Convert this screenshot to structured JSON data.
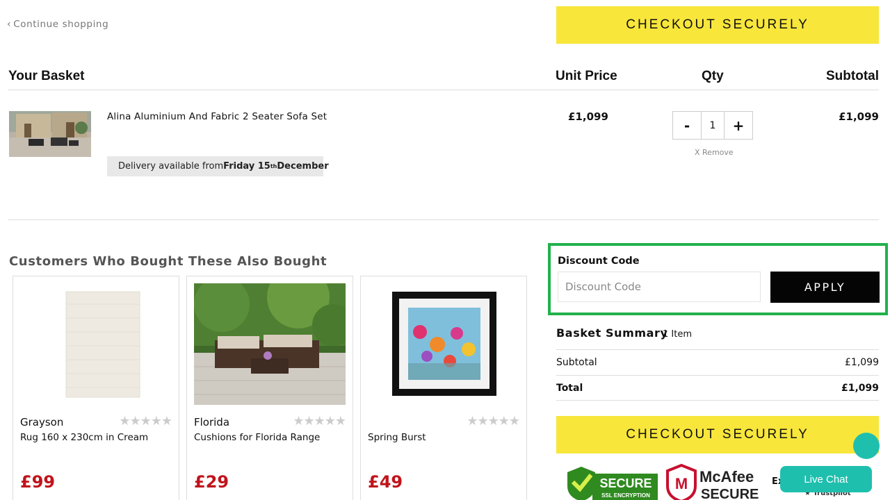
{
  "header": {
    "continue_label": "Continue shopping",
    "checkout_label": "CHECKOUT SECURELY"
  },
  "basket": {
    "title": "Your Basket",
    "columns": {
      "unit_price": "Unit Price",
      "qty": "Qty",
      "subtotal": "Subtotal"
    },
    "item": {
      "name": "Alina Aluminium And Fabric 2 Seater Sofa Set",
      "delivery_prefix": "Delivery available from ",
      "delivery_day": "Friday 15",
      "delivery_suffix": "th",
      "delivery_month": " December",
      "unit_price": "£1,099",
      "qty": "1",
      "qty_minus": "-",
      "qty_plus": "+",
      "subtotal": "£1,099",
      "remove_label": "X Remove"
    }
  },
  "recommendations": {
    "title": "Customers Who Bought These Also Bought",
    "items": [
      {
        "name": "Grayson",
        "subtitle": "Rug 160 x 230cm in Cream",
        "price": "£99",
        "rating": 0
      },
      {
        "name": "Florida",
        "subtitle": "Cushions for Florida Range",
        "price": "£29",
        "rating": 0
      },
      {
        "name": "",
        "subtitle": "Spring Burst",
        "price": "£49",
        "rating": 0
      }
    ],
    "stars": "★★★★★"
  },
  "discount": {
    "label": "Discount Code",
    "placeholder": "Discount Code",
    "apply_label": "APPLY"
  },
  "summary": {
    "title": "Basket Summary",
    "count": "1 Item",
    "subtotal_label": "Subtotal",
    "subtotal_value": "£1,099",
    "total_label": "Total",
    "total_value": "£1,099"
  },
  "footer": {
    "checkout_label": "CHECKOUT SECURELY",
    "secure_badge_text": "SECURE",
    "secure_badge_sub": "SSL ENCRYPTION",
    "mcafee_name": "McAfee",
    "mcafee_sub": "SECURE",
    "ex_text": "Ex",
    "trustpilot_text": "Trustpilot",
    "live_chat_label": "Live Chat"
  },
  "colors": {
    "checkout_yellow": "#f8e63b",
    "price_red": "#c0141c",
    "highlight_green": "#22b14c",
    "chat_teal": "#1fbfae"
  }
}
